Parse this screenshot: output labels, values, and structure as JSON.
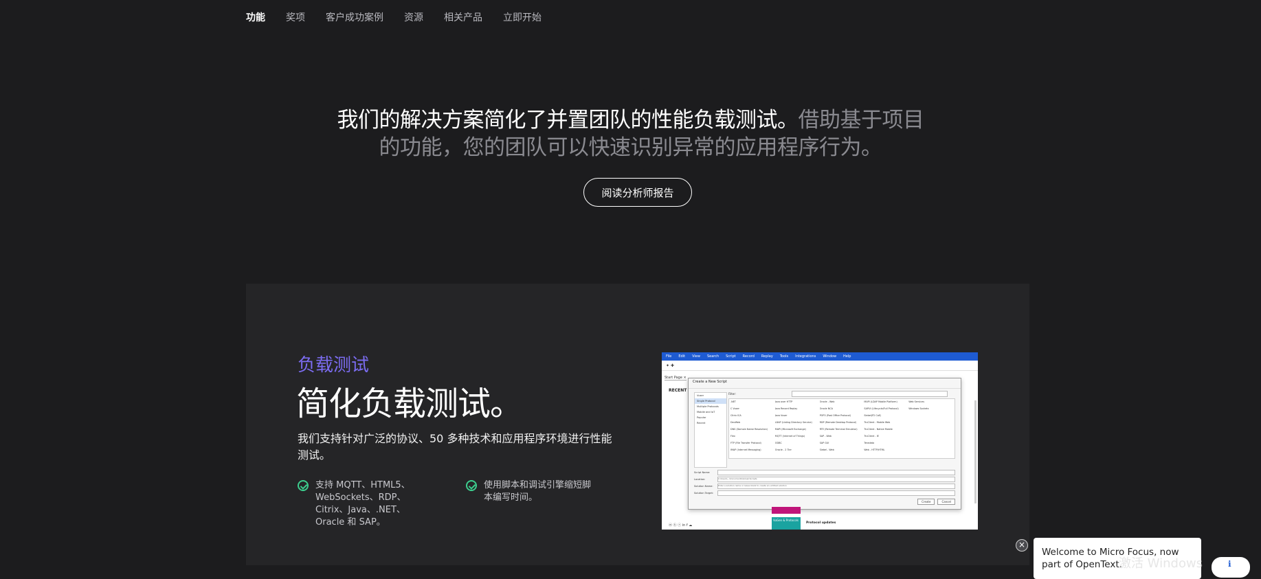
{
  "nav": {
    "items": [
      {
        "label": "功能",
        "active": true
      },
      {
        "label": "奖项",
        "active": false
      },
      {
        "label": "客户成功案例",
        "active": false
      },
      {
        "label": "资源",
        "active": false
      },
      {
        "label": "相关产品",
        "active": false
      },
      {
        "label": "立即开始",
        "active": false
      }
    ]
  },
  "hero": {
    "strong": "我们的解决方案简化了并置团队的性能负载测试。",
    "soft": "借助基于项目的功能，您的团队可以快速识别异常的应用程序行为。",
    "button_label": "阅读分析师报告"
  },
  "card": {
    "eyebrow": "负载测试",
    "title": "简化负载测试。",
    "description": "我们支持针对广泛的协议、50 多种技术和应用程序环境进行性能测试。",
    "features": [
      {
        "text": "支持 MQTT、HTML5、WebSockets、RDP、Citrix、Java、.NET、Oracle 和 SAP。"
      },
      {
        "text": "使用脚本和调试引擎缩短脚本编写时间。"
      }
    ]
  },
  "screenshot": {
    "menu": [
      "File",
      "Edit",
      "View",
      "Search",
      "Script",
      "Record",
      "Replay",
      "Tools",
      "Integrations",
      "Window",
      "Help"
    ],
    "toolbar": "✦ ✚",
    "tab": "Start Page ×",
    "recent": "RECENT AC",
    "dialog_title": "Create a New Script",
    "filter_label": "Filter:",
    "categories": [
      "Vuser",
      "Single Protocol",
      "Multiple Protocols",
      "Mobile and IoT",
      "Popular",
      "Recent"
    ],
    "protocols": [
      ".NET",
      "Java over HTTP",
      "Oracle - Web",
      "MAPI (LDAP Mobile Platform)",
      "Web Services",
      "C Vuser",
      "Java Record Replay",
      "Oracle NCA",
      "SAPUI (Lifecycle/Full Protocol)",
      "Windows Sockets",
      "Citrix ICA",
      "Java Vuser",
      "POP3 (Post Office Protocol)",
      "Siebel(P2 CoE)",
      "",
      "DevWeb",
      "LDAP (Listing Directory Service)",
      "RDP (Remote Desktop Protocol)",
      "TruClient - Mobile Web",
      "",
      "DNS (Domain Name Resolution)",
      "MAPI (Microsoft Exchange)",
      "RTE (Remote Terminal Emulator)",
      "TruClient - Native Mobile",
      "",
      "Flex",
      "MQTT (Internet of Things)",
      "SAP - Web",
      "TruClient - IE",
      "",
      "FTP (File Transfer Protocol)",
      "ODBC",
      "SAP GUI",
      "Teradata",
      "",
      "IMAP (Internet Messaging)",
      "Oracle - 2 Tier",
      "Siebel - Web",
      "Web - HTTP/HTML",
      ""
    ],
    "fields": [
      {
        "label": "Script Name:",
        "value": ""
      },
      {
        "label": "Location:",
        "value": "C:\\Users\\...\\Documents\\VuGen\\Scripts"
      },
      {
        "label": "Solution Name:",
        "value": "Enter a solution name or leave blank to create an untitled solution"
      },
      {
        "label": "Solution Target:",
        "value": ""
      }
    ],
    "buttons": [
      "Create",
      "Cancel"
    ],
    "teal_label": "VuGen & Protocols",
    "protocol_updates": "Protocol updates",
    "social": "ⓦ ⓗ ⓡ  in f ☁"
  },
  "popup": {
    "close": "×",
    "text": "Welcome to Micro Focus, now part of OpenText."
  },
  "watermark": "激活 Windows",
  "chat_fab": "ℹ"
}
